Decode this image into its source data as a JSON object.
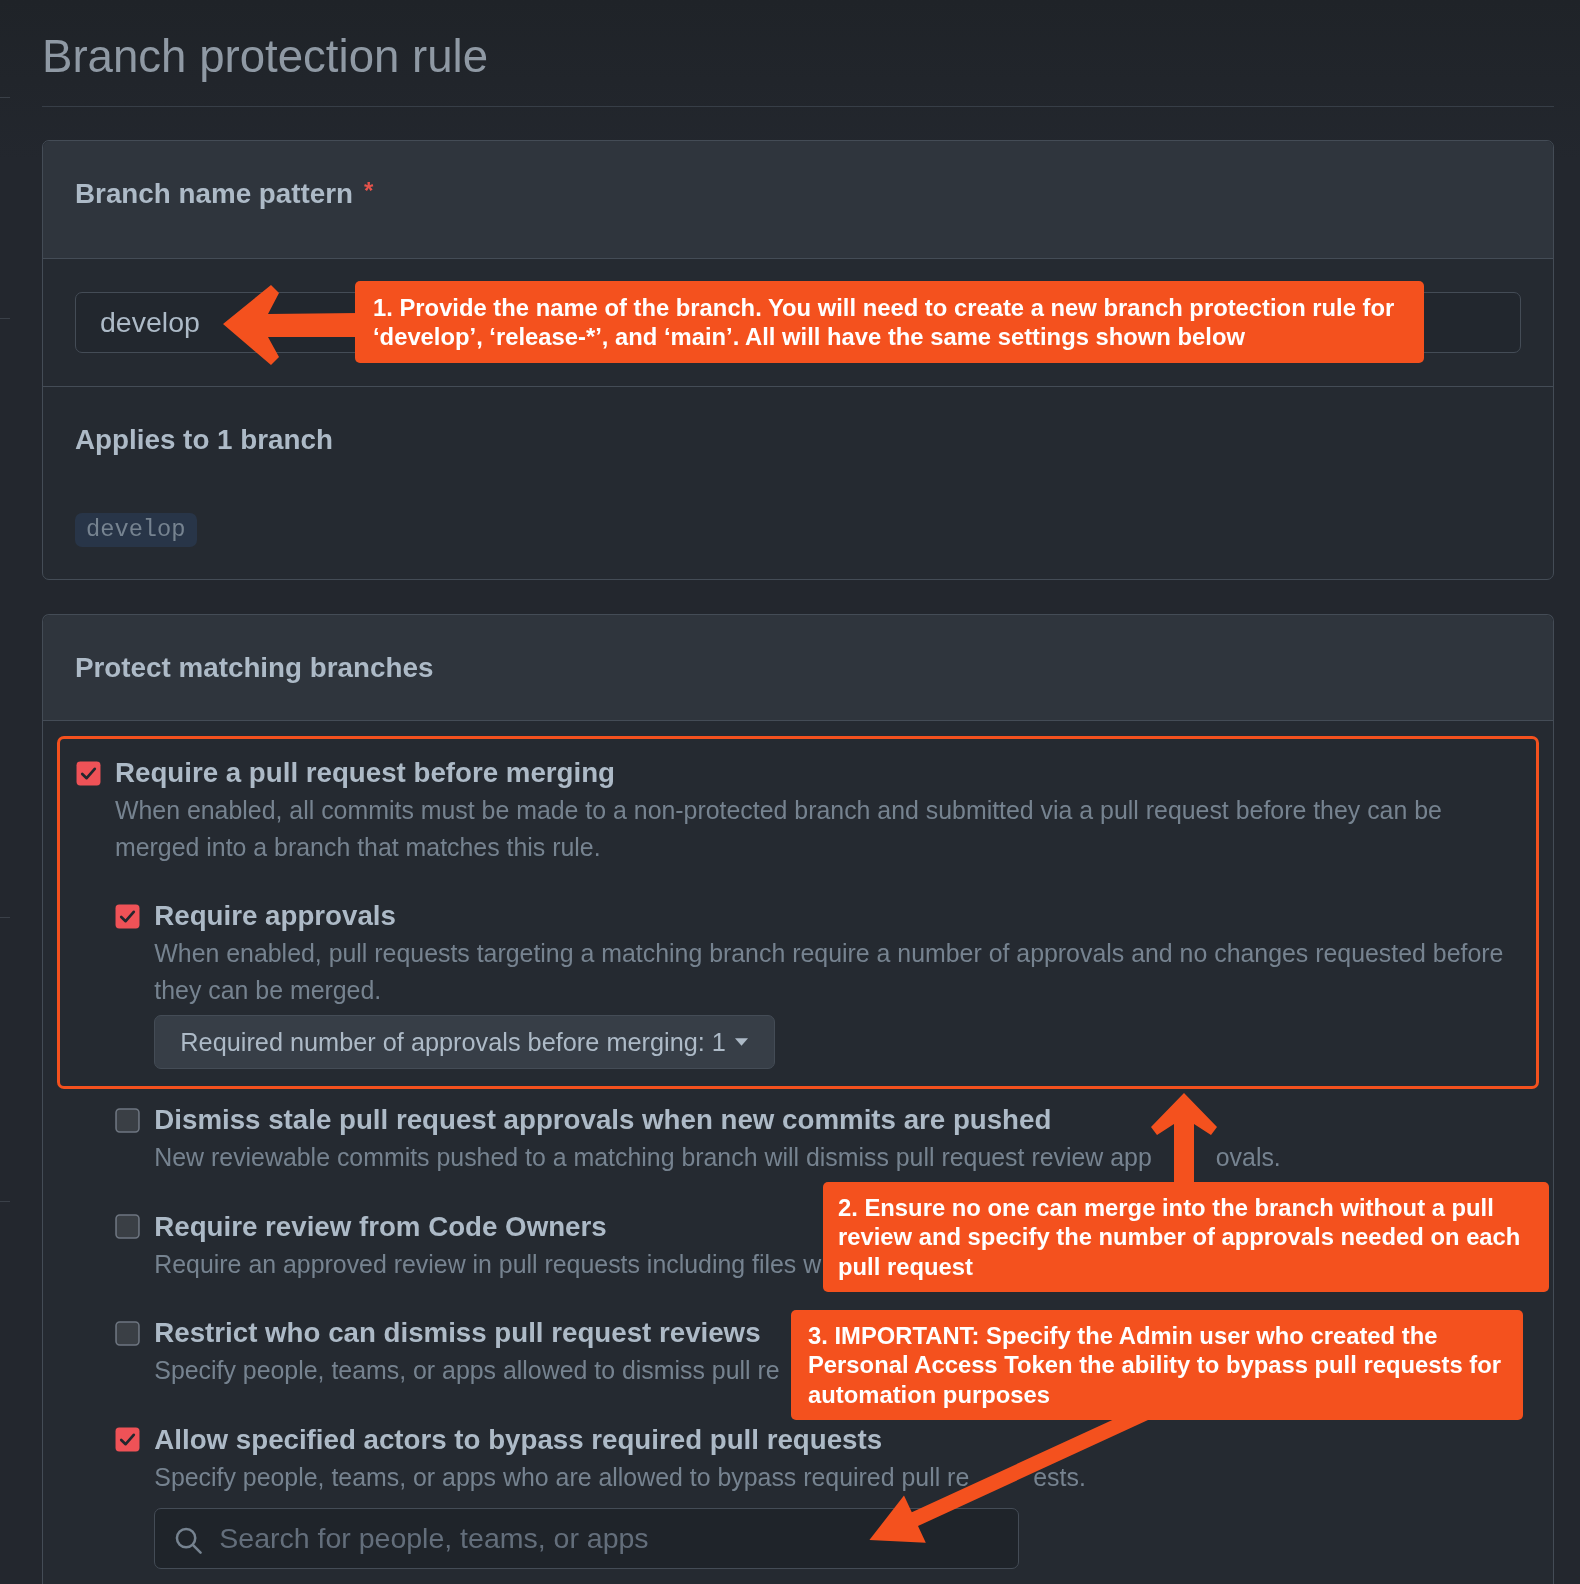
{
  "page": {
    "title": "Branch protection rule"
  },
  "branch_pattern": {
    "label": "Branch name pattern",
    "required_mark": "*",
    "value": "develop"
  },
  "applies": {
    "heading": "Applies to 1 branch",
    "branches": [
      "develop"
    ]
  },
  "protect": {
    "heading": "Protect matching branches",
    "rules": [
      {
        "title": "Require a pull request before merging",
        "description": [
          "When enabled, all commits must be made to a non-protected branch and submitted via a pull request before they can be merged into a branch that matches this rule."
        ],
        "checked": true,
        "highlighted": true,
        "children": [
          {
            "kind": "select",
            "title": "Require approvals",
            "description": [
              "When enabled, pull requests targeting a matching branch require a number of approvals and no changes requested before they can be merged."
            ],
            "checked": true,
            "highlighted": true,
            "select": {
              "value": "Required number of approvals before merging: 1"
            }
          },
          {
            "kind": "plain",
            "title": "Dismiss stale pull request approvals when new commits are pushed",
            "description": [
              "New reviewable commits pushed to a matching branch will dismiss pull request review app",
              "ovals."
            ],
            "checked": false,
            "highlighted": false
          },
          {
            "kind": "plain",
            "title": "Require review from Code Owners",
            "description": [
              "Require an approved review in pull requests including files w"
            ],
            "checked": false,
            "highlighted": false
          },
          {
            "kind": "plain",
            "title": "Restrict who can dismiss pull request reviews",
            "description": [
              "Specify people, teams, or apps allowed to dismiss pull re"
            ],
            "checked": false,
            "highlighted": false
          },
          {
            "kind": "search",
            "title": "Allow specified actors to bypass required pull requests",
            "description": [
              "Specify people, teams, or apps who are allowed to bypass required pull re",
              "ests."
            ],
            "checked": true,
            "highlighted": false,
            "search": {
              "placeholder": "Search for people, teams, or apps"
            }
          }
        ]
      }
    ]
  },
  "callouts": [
    {
      "text": "1. Provide the name of the branch. You will need to create a new branch protection rule for ‘develop’, ‘release-*’, and ‘main’. All will have the same settings shown below",
      "kind": "left"
    },
    {
      "text": "2. Ensure no one can merge into the branch without a pull review and specify the number of approvals needed on each pull request",
      "kind": "up"
    },
    {
      "text": "3. IMPORTANT: Specify the Admin user who created the Personal Access Token the ability to bypass pull requests for automation purposes",
      "kind": "down-left"
    }
  ]
}
